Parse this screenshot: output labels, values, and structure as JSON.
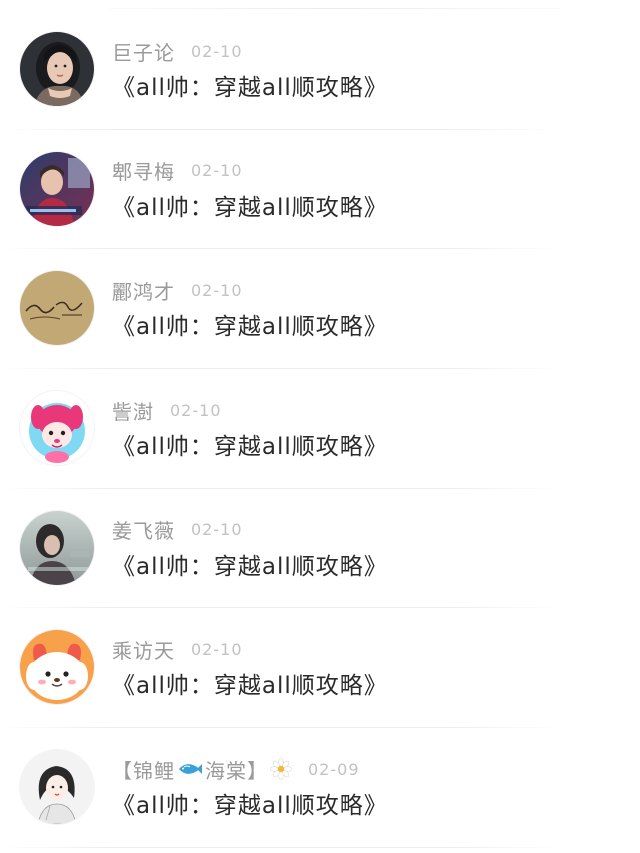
{
  "comments": [
    {
      "username": "巨子论",
      "date": "02-10",
      "text": "《all帅：穿越all顺攻略》",
      "avatar": "avatar-woman-portrait-icon"
    },
    {
      "username": "郫寻梅",
      "date": "02-10",
      "text": "《all帅：穿越all顺攻略》",
      "avatar": "avatar-man-portrait-icon"
    },
    {
      "username": "酈鸿才",
      "date": "02-10",
      "text": "《all帅：穿越all顺攻略》",
      "avatar": "avatar-handwriting-icon"
    },
    {
      "username": "訾澍",
      "date": "02-10",
      "text": "《all帅：穿越all顺攻略》",
      "avatar": "avatar-cartoon-pink-icon"
    },
    {
      "username": "姜飞薇",
      "date": "02-10",
      "text": "《all帅：穿越all顺攻略》",
      "avatar": "avatar-girl-photo-icon"
    },
    {
      "username": "乘访天",
      "date": "02-10",
      "text": "《all帅：穿越all顺攻略》",
      "avatar": "avatar-cartoon-dog-icon"
    },
    {
      "username_prefix": "【锦鲤",
      "username_suffix": "海棠】",
      "date": "02-09",
      "text": "《all帅：穿越all顺攻略》",
      "avatar": "avatar-sketch-girl-icon",
      "badges": [
        "fish-icon",
        "flower-icon"
      ]
    }
  ],
  "colors": {
    "username": "#9a9a9a",
    "date": "#c2c2c2",
    "text": "#2a2a2a"
  }
}
